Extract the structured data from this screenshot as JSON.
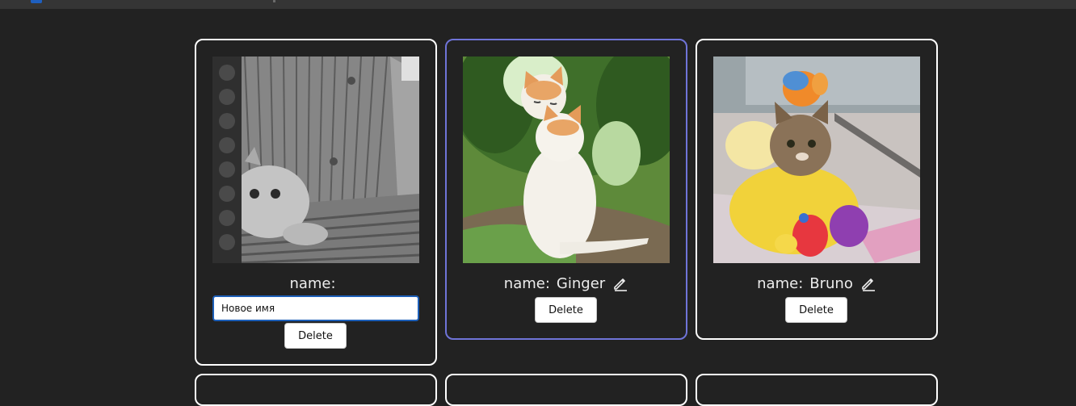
{
  "cards": [
    {
      "name_label": "name:",
      "name_value": "",
      "edit_value": "Новое имя",
      "delete_label": "Delete",
      "editing": true
    },
    {
      "name_label": "name:",
      "name_value": "Ginger",
      "delete_label": "Delete",
      "editing": false,
      "selected": true
    },
    {
      "name_label": "name:",
      "name_value": "Bruno",
      "delete_label": "Delete",
      "editing": false
    }
  ],
  "colors": {
    "background": "#222222",
    "card_border": "#ffffff",
    "selected_border": "#6f74d8",
    "input_focus_border": "#1d5fb8"
  },
  "icons": {
    "edit": "pencil-icon"
  }
}
